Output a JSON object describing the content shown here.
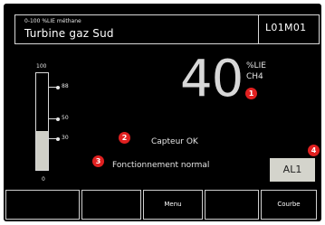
{
  "header": {
    "range_label": "0-100 %LIE méthane",
    "device_name": "Turbine gaz Sud",
    "device_code": "L01M01"
  },
  "gauge": {
    "max_label": "100",
    "min_label": "0",
    "level_percent": 40,
    "ticks": [
      "88",
      "50",
      "30"
    ]
  },
  "reading": {
    "value": "40",
    "unit": "%LIE",
    "gas": "CH4"
  },
  "status": {
    "sensor": "Capteur OK",
    "operation": "Fonctionnement normal"
  },
  "alarm": {
    "label": "AL1"
  },
  "markers": [
    "1",
    "2",
    "3",
    "4"
  ],
  "function_keys": [
    "",
    "",
    "Menu",
    "",
    "Courbe"
  ],
  "colors": {
    "screen": "#000000",
    "text": "#e6e6e6",
    "marker": "#e02020",
    "gauge_fill": "#d0d0c8",
    "alarm_bg": "#d4d4cc"
  }
}
